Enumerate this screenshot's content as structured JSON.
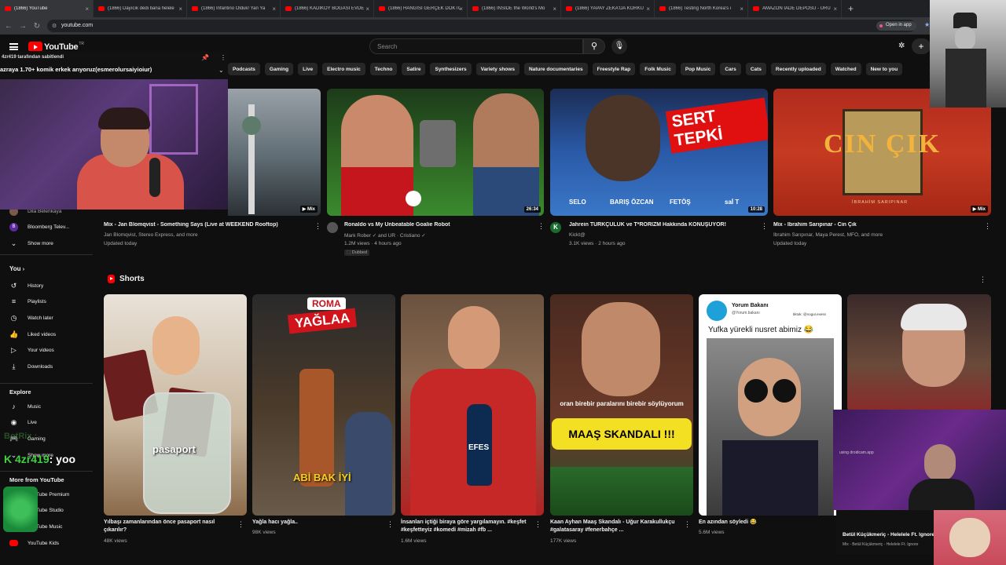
{
  "browser": {
    "tabs": [
      {
        "label": "(1866) YouTube",
        "active": true
      },
      {
        "label": "(1866) Dayıcık dedi bana helele",
        "active": false
      },
      {
        "label": "(1866) Infantino Olduk! Yan Ya",
        "active": false
      },
      {
        "label": "(1866) KADIKÖY BOĞASI EVDE",
        "active": false
      },
      {
        "label": "(1866) HANGİSİ GERÇEK DOKTOR",
        "active": false
      },
      {
        "label": "(1866) INSIDE the World's Mo",
        "active": false
      },
      {
        "label": "(1866) YAPAY ZEKA'DA KORKU",
        "active": false
      },
      {
        "label": "(1866) Testing North Korea's i",
        "active": false
      },
      {
        "label": "AMAZON İADE DEPOSU - ÜRÜ",
        "active": false
      }
    ],
    "url": "youtube.com",
    "open_in_app": "Open in app"
  },
  "masthead": {
    "logo_text": "YouTube",
    "logo_region": "TR",
    "search_placeholder": "Search",
    "create_label": "+",
    "create_partial": "C"
  },
  "chips": [
    "Podcasts",
    "Gaming",
    "Live",
    "Electro music",
    "Techno",
    "Satire",
    "Synthesizers",
    "Variety shows",
    "Nature documentaries",
    "Freestyle Rap",
    "Folk Music",
    "Pop Music",
    "Cars",
    "Cats",
    "Recently uploaded",
    "Watched",
    "New to you"
  ],
  "pinned": {
    "pinned_by": "4zr419 tarafından sabitlendi",
    "message": "azraya 1.70+ komik erkek arıyoruz(esmerolursaiyioiur)"
  },
  "sidebar": {
    "subs": [
      {
        "label": "Dila Belenkaya",
        "color": "#7a5a4a"
      },
      {
        "label": "Bloomberg Telev...",
        "color": "#8a2be2"
      }
    ],
    "show_more": "Show more",
    "you_title": "You",
    "you_items": [
      {
        "label": "History",
        "icon": "history-icon"
      },
      {
        "label": "Playlists",
        "icon": "playlists-icon"
      },
      {
        "label": "Watch later",
        "icon": "watch-later-icon"
      },
      {
        "label": "Liked videos",
        "icon": "liked-icon"
      },
      {
        "label": "Your videos",
        "icon": "your-videos-icon"
      },
      {
        "label": "Downloads",
        "icon": "downloads-icon"
      }
    ],
    "explore_title": "Explore",
    "explore_items": [
      {
        "label": "Music",
        "icon": "music-icon"
      },
      {
        "label": "Live",
        "icon": "live-icon"
      },
      {
        "label": "Gaming",
        "icon": "gaming-icon"
      },
      {
        "label": "Show more",
        "icon": "chevron-down-icon"
      }
    ],
    "more_title": "More from YouTube",
    "more_items": [
      {
        "label": "YouTube Premium"
      },
      {
        "label": "YouTube Studio"
      },
      {
        "label": "YouTube Music"
      },
      {
        "label": "YouTube Kids"
      }
    ]
  },
  "videos": [
    {
      "title": "Mix - Jan Blomqvist - Something Says (Live at WEEKEND Rooftop)",
      "meta1": "Jan Blomqvist, Stereo Express, and more",
      "meta2": "Updated today",
      "badge": "Mix"
    },
    {
      "title": "Ronaldo vs My Unbeatable Goalie Robot",
      "meta1": "Mark Rober ✓ and UR · Cristiano ✓",
      "meta2": "1.2M views · 4 hours ago",
      "badge": "26:34",
      "dubbed": "Dubbed"
    },
    {
      "title": "Jahrein TÜRKÇÜLÜK ve T*RÖRİZM Hakkında KONUŞUYOR!",
      "meta1": "Kickt@",
      "meta2": "3.1K views · 2 hours ago",
      "badge": "10:28",
      "overlay": "SERT TEPKİ",
      "labels": [
        "SELO",
        "BARIŞ ÖZCAN",
        "FETÖŞ",
        "saİ T"
      ]
    },
    {
      "title": "Mix - İbrahim Sarıpınar - Cin Çık",
      "meta1": "İbrahim Sarıpınar, Maya Perest, MFÖ, and more",
      "meta2": "Updated today",
      "badge": "Mix",
      "overlay": "CIN ÇIK",
      "sub_overlay": "İBRAHİM SARIPINAR"
    }
  ],
  "shorts": {
    "title": "Shorts",
    "items": [
      {
        "title": "Yılbaşı zamanlarından önce pasaport nasıl çıkarılır?",
        "views": "48K views",
        "overlay": "pasaport"
      },
      {
        "title": "Yağla hacı yağla..",
        "views": "98K views",
        "overlay_top": "ROMA",
        "overlay": "YAĞLAA",
        "overlay_bottom": "ABİ BAK İYİ"
      },
      {
        "title": "İnsanları içtiği biraya göre yargılamayın. #keşfet #keşfetteyiz #komedi #mizah #fb ...",
        "views": "1.6M views",
        "overlay": "EFES"
      },
      {
        "title": "Kaan Ayhan Maaş Skandalı - Uğur Karakullukçu #galatasaray #fenerbahçe ...",
        "views": "177K views",
        "overlay_top": "oran birebir paralarını birebir söylüyorum",
        "overlay": "MAAŞ SKANDALI !!!"
      },
      {
        "title": "En azından söyledi 😂",
        "views": "5.6M views",
        "account": "Yorum Bakanı",
        "account_handle": "@Yorum.bakanı",
        "tiktok": "tiktok: @nogur.exess",
        "caption": "Yufka yürekli nusret abimiz 😂"
      },
      {
        "title": "Betül Küçükmeriç - Helelele Ft. Ignore",
        "views": "Mix - Betül Küçükmeriç - Helelele Ft. Ignore"
      }
    ]
  },
  "stream_overlay": {
    "chat_name": "4zr419",
    "chat_text": ": yoo",
    "ghost_text": "BotRix :",
    "cam_text": "using droidcam.app"
  }
}
